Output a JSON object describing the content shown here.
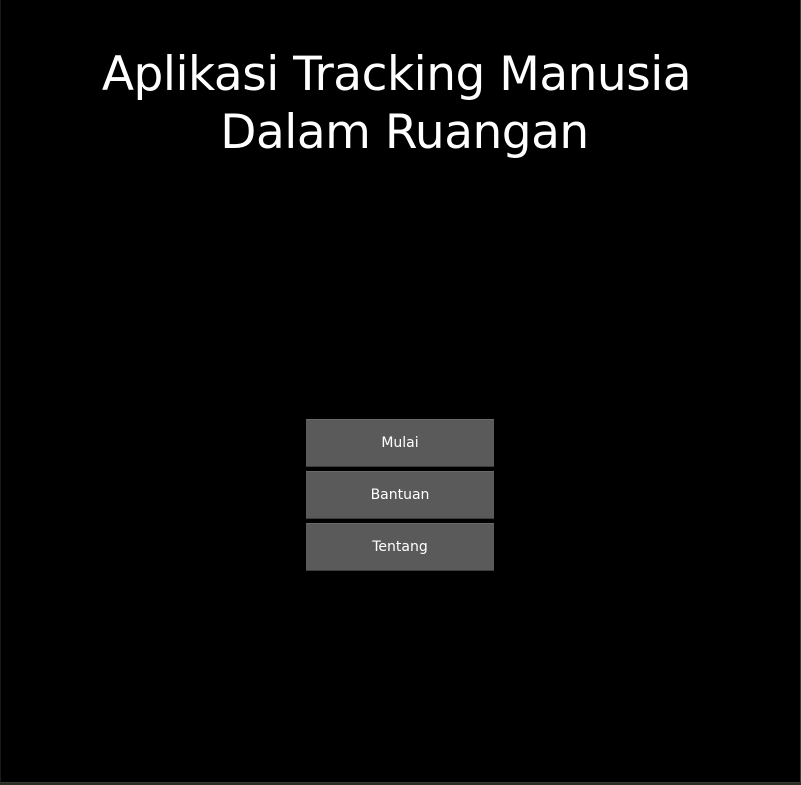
{
  "app": {
    "title_line1": "Aplikasi Tracking Manusia",
    "title_line2": "Dalam Ruangan"
  },
  "menu": {
    "items": [
      {
        "label": "Mulai"
      },
      {
        "label": "Bantuan"
      },
      {
        "label": "Tentang"
      }
    ]
  },
  "colors": {
    "background": "#000000",
    "button": "#5a5a5a",
    "text": "#ffffff"
  }
}
